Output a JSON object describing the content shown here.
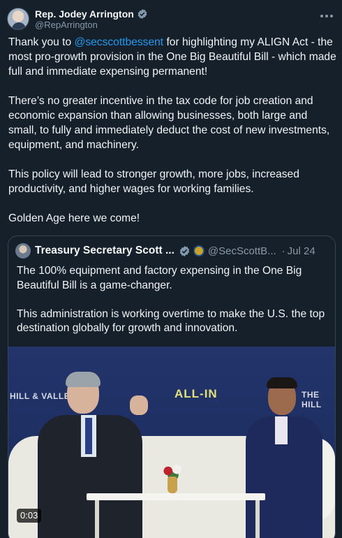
{
  "author": {
    "name": "Rep. Jodey Arrington",
    "handle": "@RepArrington",
    "verified_icon": "verified-badge-icon",
    "more_icon": "more-options-icon"
  },
  "post": {
    "p1_pre": "Thank you to ",
    "p1_mention": "@secscottbessent",
    "p1_post": " for highlighting my ALIGN Act - the most pro-growth provision in the One Big Beautiful Bill - which made full and immediate expensing permanent!",
    "p2": "There’s no greater incentive in the tax code for job creation and economic expansion than allowing businesses, both large and small, to fully and immediately deduct the cost of new investments, equipment, and machinery.",
    "p3": "This policy will lead to stronger growth, more jobs, increased productivity, and higher wages for working families.",
    "p4": "Golden Age here we come!"
  },
  "quoted": {
    "name": "Treasury Secretary Scott ...",
    "handle": "@SecScottB...",
    "separator": "·",
    "date": "Jul 24",
    "text_p1": "The 100% equipment and factory expensing in the One Big Beautiful Bill is a game-changer.",
    "text_p2": "This administration is working overtime to make the U.S. the top destination globally for growth and innovation.",
    "media": {
      "duration": "0:03",
      "banner_left": "HILL & VALLEY",
      "banner_center": "ALL-IN",
      "banner_right": "THE HILL"
    }
  },
  "colors": {
    "background": "#15202b",
    "link": "#1d9bf0",
    "secondary_text": "#8b98a5",
    "border": "#38444d"
  }
}
